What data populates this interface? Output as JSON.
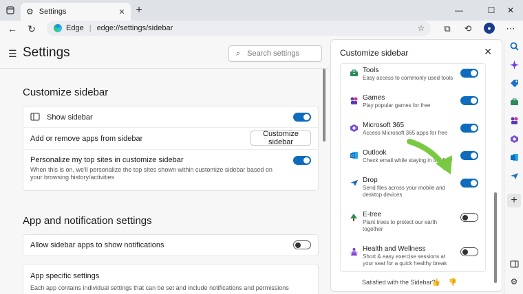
{
  "browser": {
    "tab_title": "Settings",
    "brand": "Edge",
    "separator": "|",
    "url": "edge://settings/sidebar"
  },
  "settings": {
    "title": "Settings",
    "search_placeholder": "Search settings",
    "customize": {
      "heading": "Customize sidebar",
      "show_sidebar": {
        "label": "Show sidebar",
        "enabled": true
      },
      "add_remove": {
        "label": "Add or remove apps from sidebar",
        "button": "Customize sidebar"
      },
      "personalize": {
        "label": "Personalize my top sites in customize sidebar",
        "description": "When this is on, we'll personalize the top sites shown within customize sidebar based on your browsing history/activities",
        "enabled": true
      }
    },
    "notifications": {
      "heading": "App and notification settings",
      "allow": {
        "label": "Allow sidebar apps to show notifications",
        "enabled": false
      },
      "app_specific": {
        "label": "App specific settings",
        "description": "Each app contains individual settings that can be set and include notifications and permissions"
      }
    }
  },
  "panel": {
    "title": "Customize sidebar",
    "apps": [
      {
        "name": "Tools",
        "description": "Easy access to commonly used tools",
        "enabled": true,
        "icon": "toolbox-icon",
        "color": "#2a8a5c"
      },
      {
        "name": "Games",
        "description": "Play popular games for free",
        "enabled": true,
        "icon": "games-icon",
        "color": "#5b3bb5"
      },
      {
        "name": "Microsoft 365",
        "description": "Access Microsoft 365 apps for free",
        "enabled": true,
        "icon": "m365-icon",
        "color": "#7a4bd6"
      },
      {
        "name": "Outlook",
        "description": "Check email while staying in the flow",
        "enabled": true,
        "icon": "outlook-icon",
        "color": "#0f6cbd"
      },
      {
        "name": "Drop",
        "description": "Send files across your mobile and desktop devices",
        "enabled": true,
        "icon": "drop-icon",
        "color": "#1a73c8"
      },
      {
        "name": "E-tree",
        "description": "Plant trees to protect our earth together",
        "enabled": false,
        "icon": "etree-icon",
        "color": "#2f8f4e"
      },
      {
        "name": "Health and Wellness",
        "description": "Short & easy exercise sessions at your seat for a quick healthy break",
        "enabled": false,
        "icon": "health-icon",
        "color": "#7a3fd1"
      }
    ],
    "feedback": "Satisfied with the Sidebar?"
  },
  "colors": {
    "accent": "#0f6cbd",
    "arrow": "#7ac943"
  }
}
